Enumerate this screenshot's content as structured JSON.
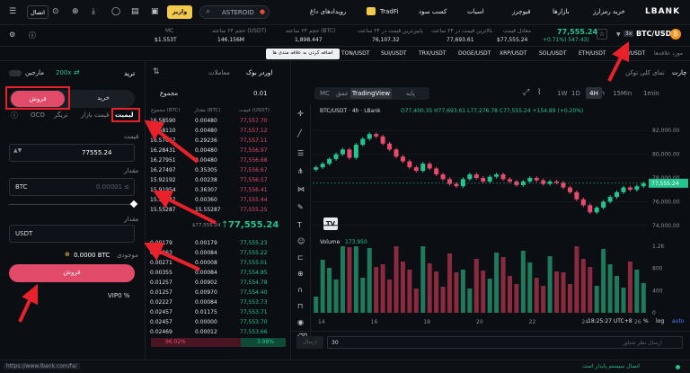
{
  "nav": {
    "logo": "LBANK",
    "items": [
      "خرید رمزارز",
      "بازارها",
      "فیوچرز",
      "اسیات",
      "کسب سود",
      "TradFi",
      "رویدادهای داغ"
    ],
    "search": "ASTEROID",
    "deposit": "واریز",
    "login": "اتصال"
  },
  "ticker": {
    "pair": "BTC/USDT",
    "leverage": "3x",
    "price": "77,555.24",
    "change": "+0.71%) 547.43)",
    "stats": [
      {
        "label": "معادل قیمت",
        "value": "$77,555.24"
      },
      {
        "label": "بالاترین قیمت در ۲۴ ساعت",
        "value": "77,693.61"
      },
      {
        "label": "پایین‌ترین قیمت در ۲۴ ساعت",
        "value": "76,107.32"
      },
      {
        "label": "حجم ۲۴ ساعته (BTC)",
        "value": "1,898.447"
      },
      {
        "label": "حجم ۲۴ ساعته (USDT)",
        "value": "146.156M"
      },
      {
        "label": "MC",
        "value": "$1.553T"
      }
    ]
  },
  "fav": {
    "label": "مورد علاقه‌ها",
    "pairs": [
      "BTC/USDT",
      "ETH/USDT",
      "SOL/USDT",
      "XRP/USDT",
      "DOGE/USDT",
      "TRX/USDT",
      "SUI/USDT",
      "TON/USDT"
    ],
    "add": "اضافه کردن به علاقه مندی ها"
  },
  "trade": {
    "tab": "ترید",
    "margin": "مارجین",
    "leverage": "200x",
    "buy": "خرید",
    "sell": "فروش",
    "order_types": [
      "لیمیت",
      "قیمت بازار",
      "تریگر",
      "OCO"
    ],
    "price_label": "قیمت",
    "price_value": "77555.24",
    "amount_label": "مقدار",
    "amount_unit": "BTC",
    "amount_placeholder": "0.00001 ≤",
    "total_label": "مقدار",
    "total_unit": "USDT",
    "available_label": "موجودی",
    "available_value": "0.0000 BTC",
    "submit": "فروش",
    "vip": "VIP0 %"
  },
  "book": {
    "tabs": [
      "اوردر بوک",
      "معاملات"
    ],
    "precision": "0.01",
    "group": "مجموع",
    "headers": [
      "قیمت (USDT)",
      "مقدار (BTC)",
      "مجموع (BTC)"
    ],
    "asks": [
      [
        "77,557.70",
        "0.00480",
        "16.58590"
      ],
      [
        "77,557.12",
        "0.00480",
        "16.58110"
      ],
      [
        "77,557.11",
        "0.29236",
        "16.57667"
      ],
      [
        "77,556.97",
        "0.00480",
        "16.28431"
      ],
      [
        "77,556.68",
        "0.00480",
        "16.27951"
      ],
      [
        "77,556.67",
        "0.35305",
        "16.27497"
      ],
      [
        "77,556.57",
        "0.00238",
        "15.92192"
      ],
      [
        "77,556.41",
        "0.36307",
        "15.91954"
      ],
      [
        "77,555.44",
        "0.00360",
        "15.55647"
      ],
      [
        "77,555.25",
        "15.55287",
        "15.55287"
      ]
    ],
    "mid_price": "77,555.24",
    "mid_usd": "$77,555.24",
    "bids": [
      [
        "77,555.23",
        "0.00179",
        "0.00179"
      ],
      [
        "77,555.22",
        "0.00084",
        "0.00263"
      ],
      [
        "77,555.01",
        "0.00008",
        "0.00271"
      ],
      [
        "77,554.85",
        "0.00084",
        "0.00355"
      ],
      [
        "77,554.78",
        "0.00902",
        "0.01257"
      ],
      [
        "77,554.40",
        "0.00970",
        "0.01257"
      ],
      [
        "77,553.73",
        "0.00084",
        "0.02227"
      ],
      [
        "77,553.71",
        "0.01175",
        "0.02457"
      ],
      [
        "77,553.70",
        "0.00000",
        "0.02457"
      ],
      [
        "77,553.66",
        "0.00012",
        "0.02469"
      ]
    ],
    "buy_pct": "96.02%",
    "sell_pct": "3.98%"
  },
  "chart_tabs": {
    "chart": "چارت",
    "overview": "نمای کلی توکن",
    "intervals": [
      "1min",
      "15Min",
      "1h",
      "4H",
      "1D",
      "1W"
    ],
    "styles": [
      "پایه",
      "TradingView",
      "عمق",
      "MC"
    ]
  },
  "chart_meta": {
    "pair_line": "BTC/USDT · 4h · LBank",
    "ohlc": "O77,400.35 H77,693.61 L77,276.78 C77,555.24 +154.89 (+0.20%)",
    "volume_label": "Volume",
    "volume_value": "173.950",
    "price_tag": "77,555.24",
    "time": "18:25:27 UTC+8",
    "pct": "%",
    "log": "log",
    "auto": "auto",
    "footer_input": "30",
    "footer_send": "ارسال",
    "footer_placeholder": "ارسال نظر شناور"
  },
  "chart_data": {
    "type": "line",
    "x_ticks": [
      "14",
      "16",
      "18",
      "20",
      "22",
      "24",
      "26"
    ],
    "y_ticks": [
      "82,000.00",
      "80,000.00",
      "78,000.00",
      "76,000.00",
      "74,000.00"
    ],
    "volume_ticks": [
      "1.2K",
      "800",
      "400",
      "0"
    ],
    "ylim": [
      73000,
      83000
    ],
    "close_series": [
      78900,
      79200,
      79600,
      80000,
      80400,
      79700,
      80800,
      81300,
      81700,
      81500,
      80900,
      80400,
      79800,
      79400,
      78900,
      78600,
      79200,
      78800,
      78300,
      77900,
      77500,
      77300,
      77900,
      78300,
      78000,
      77700,
      78100,
      78300,
      77900,
      77700,
      77400,
      77700,
      78000,
      77800,
      77500,
      77700,
      77600,
      77200,
      76800,
      76200,
      75700,
      75100,
      75500,
      76000,
      76400,
      76800,
      77200,
      77000,
      77300,
      77555
    ]
  },
  "status": {
    "url": "https://www.lbank.com/fa/",
    "text": "اتصال سیستم پایدار است"
  }
}
